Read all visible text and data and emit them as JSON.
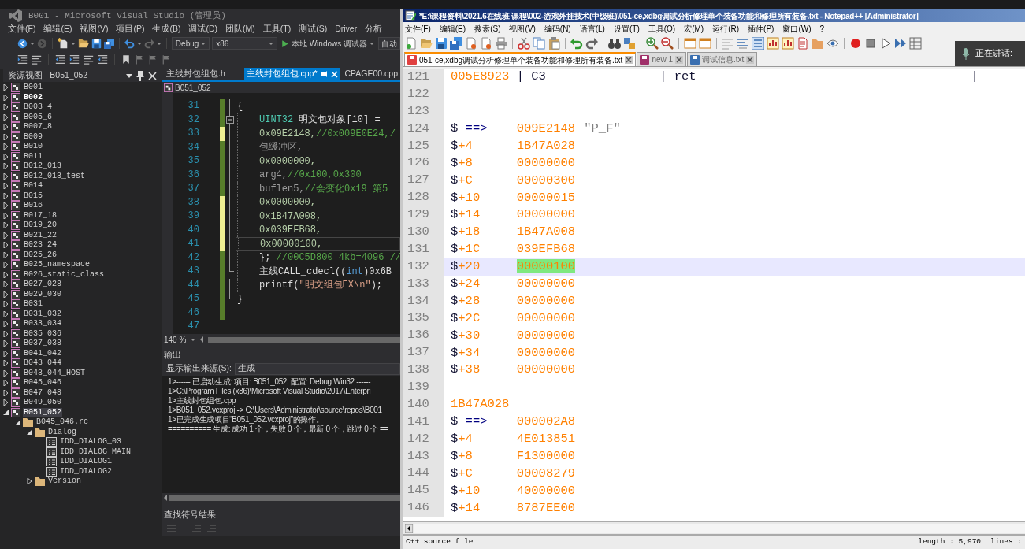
{
  "vs": {
    "title": "B001 - Microsoft Visual Studio (管理员)",
    "menu": [
      "文件(F)",
      "编辑(E)",
      "视图(V)",
      "项目(P)",
      "生成(B)",
      "调试(D)",
      "团队(M)",
      "工具(T)",
      "测试(S)",
      "Driver",
      "分析"
    ],
    "toolbar": {
      "configuration": "Debug",
      "platform": "x86",
      "run_button": "本地 Windows 调试器",
      "run_target": "自动"
    },
    "resource_view": {
      "title": "资源视图 - B051_052",
      "tree": [
        {
          "label": "B001",
          "kind": "project",
          "expanded": false,
          "selected": false,
          "bold": false
        },
        {
          "label": "B002",
          "kind": "project",
          "expanded": false,
          "selected": false,
          "bold": true
        },
        {
          "label": "B003_4",
          "kind": "project",
          "expanded": false,
          "selected": false,
          "bold": false
        },
        {
          "label": "B005_6",
          "kind": "project",
          "expanded": false,
          "selected": false,
          "bold": false
        },
        {
          "label": "B007_8",
          "kind": "project",
          "expanded": false,
          "selected": false,
          "bold": false
        },
        {
          "label": "B009",
          "kind": "project",
          "expanded": false,
          "selected": false,
          "bold": false
        },
        {
          "label": "B010",
          "kind": "project",
          "expanded": false,
          "selected": false,
          "bold": false
        },
        {
          "label": "B011",
          "kind": "project",
          "expanded": false,
          "selected": false,
          "bold": false
        },
        {
          "label": "B012_013",
          "kind": "project",
          "expanded": false,
          "selected": false,
          "bold": false
        },
        {
          "label": "B012_013_test",
          "kind": "project",
          "expanded": false,
          "selected": false,
          "bold": false
        },
        {
          "label": "B014",
          "kind": "project",
          "expanded": false,
          "selected": false,
          "bold": false
        },
        {
          "label": "B015",
          "kind": "project",
          "expanded": false,
          "selected": false,
          "bold": false
        },
        {
          "label": "B016",
          "kind": "project",
          "expanded": false,
          "selected": false,
          "bold": false
        },
        {
          "label": "B017_18",
          "kind": "project",
          "expanded": false,
          "selected": false,
          "bold": false
        },
        {
          "label": "B019_20",
          "kind": "project",
          "expanded": false,
          "selected": false,
          "bold": false
        },
        {
          "label": "B021_22",
          "kind": "project",
          "expanded": false,
          "selected": false,
          "bold": false
        },
        {
          "label": "B023_24",
          "kind": "project",
          "expanded": false,
          "selected": false,
          "bold": false
        },
        {
          "label": "B025_26",
          "kind": "project",
          "expanded": false,
          "selected": false,
          "bold": false
        },
        {
          "label": "B025_namespace",
          "kind": "project",
          "expanded": false,
          "selected": false,
          "bold": false
        },
        {
          "label": "B026_static_class",
          "kind": "project",
          "expanded": false,
          "selected": false,
          "bold": false
        },
        {
          "label": "B027_028",
          "kind": "project",
          "expanded": false,
          "selected": false,
          "bold": false
        },
        {
          "label": "B029_030",
          "kind": "project",
          "expanded": false,
          "selected": false,
          "bold": false
        },
        {
          "label": "B031",
          "kind": "project",
          "expanded": false,
          "selected": false,
          "bold": false
        },
        {
          "label": "B031_032",
          "kind": "project",
          "expanded": false,
          "selected": false,
          "bold": false
        },
        {
          "label": "B033_034",
          "kind": "project",
          "expanded": false,
          "selected": false,
          "bold": false
        },
        {
          "label": "B035_036",
          "kind": "project",
          "expanded": false,
          "selected": false,
          "bold": false
        },
        {
          "label": "B037_038",
          "kind": "project",
          "expanded": false,
          "selected": false,
          "bold": false
        },
        {
          "label": "B041_042",
          "kind": "project",
          "expanded": false,
          "selected": false,
          "bold": false
        },
        {
          "label": "B043_044",
          "kind": "project",
          "expanded": false,
          "selected": false,
          "bold": false
        },
        {
          "label": "B043_044_HOST",
          "kind": "project",
          "expanded": false,
          "selected": false,
          "bold": false
        },
        {
          "label": "B045_046",
          "kind": "project",
          "expanded": false,
          "selected": false,
          "bold": false
        },
        {
          "label": "B047_048",
          "kind": "project",
          "expanded": false,
          "selected": false,
          "bold": false
        },
        {
          "label": "B049_050",
          "kind": "project",
          "expanded": false,
          "selected": false,
          "bold": false
        },
        {
          "label": "B051_052",
          "kind": "project",
          "expanded": true,
          "selected": true,
          "bold": false,
          "children": [
            {
              "label": "B045_046.rc",
              "kind": "folder",
              "expanded": true,
              "selected": false,
              "bold": false,
              "children": [
                {
                  "label": "Dialog",
                  "kind": "folder",
                  "expanded": true,
                  "selected": false,
                  "bold": false,
                  "children": [
                    {
                      "label": "IDD_DIALOG_03",
                      "kind": "dialog",
                      "selected": false,
                      "bold": false
                    },
                    {
                      "label": "IDD_DIALOG_MAIN",
                      "kind": "dialog",
                      "selected": false,
                      "bold": false
                    },
                    {
                      "label": "IDD_DIALOG1",
                      "kind": "dialog",
                      "selected": false,
                      "bold": false
                    },
                    {
                      "label": "IDD_DIALOG2",
                      "kind": "dialog",
                      "selected": false,
                      "bold": false
                    }
                  ]
                },
                {
                  "label": "Version",
                  "kind": "folder",
                  "expanded": false,
                  "selected": false,
                  "bold": false
                }
              ]
            }
          ]
        }
      ]
    },
    "editor": {
      "tabs": [
        {
          "label": "主线封包组包.h",
          "selected": false
        },
        {
          "label": "主线封包组包.cpp*",
          "selected": true
        },
        {
          "label": "CPAGE00.cpp",
          "selected": false
        }
      ],
      "navigation": "B051_052",
      "lines": [
        {
          "number": "31",
          "changed": true,
          "saved": true,
          "in_fold": true,
          "fold_start": false,
          "fold_end": false,
          "indented": false,
          "current": false,
          "pieces": [
            {
              "text": "{",
              "kind": "text"
            }
          ]
        },
        {
          "number": "32",
          "changed": true,
          "saved": true,
          "in_fold": true,
          "fold_start": true,
          "fold_end": false,
          "indented": true,
          "current": false,
          "pieces": [
            {
              "text": "UINT32",
              "kind": "keyword"
            },
            {
              "text": " 明文包对象[10] = ",
              "kind": "text"
            }
          ]
        },
        {
          "number": "33",
          "changed": true,
          "saved": false,
          "in_fold": true,
          "fold_start": false,
          "fold_end": false,
          "indented": true,
          "current": false,
          "pieces": [
            {
              "text": "0x09E2148,",
              "kind": "number"
            },
            {
              "text": "//0x009E0E24,/",
              "kind": "comment"
            }
          ]
        },
        {
          "number": "34",
          "changed": true,
          "saved": true,
          "in_fold": true,
          "fold_start": false,
          "fold_end": false,
          "indented": true,
          "current": false,
          "pieces": [
            {
              "text": "包缓冲区,",
              "kind": "inactive"
            }
          ]
        },
        {
          "number": "35",
          "changed": true,
          "saved": true,
          "in_fold": true,
          "fold_start": false,
          "fold_end": false,
          "indented": true,
          "current": false,
          "pieces": [
            {
              "text": "0x0000000,",
              "kind": "number"
            }
          ]
        },
        {
          "number": "36",
          "changed": true,
          "saved": true,
          "in_fold": true,
          "fold_start": false,
          "fold_end": false,
          "indented": true,
          "current": false,
          "pieces": [
            {
              "text": "arg4,",
              "kind": "inactive"
            },
            {
              "text": "//0x100,0x300",
              "kind": "comment"
            }
          ]
        },
        {
          "number": "37",
          "changed": true,
          "saved": true,
          "in_fold": true,
          "fold_start": false,
          "fold_end": false,
          "indented": true,
          "current": false,
          "pieces": [
            {
              "text": "buflen5,",
              "kind": "inactive"
            },
            {
              "text": "//会变化0x19 第5",
              "kind": "comment"
            }
          ]
        },
        {
          "number": "38",
          "changed": true,
          "saved": false,
          "in_fold": true,
          "fold_start": false,
          "fold_end": false,
          "indented": true,
          "current": false,
          "pieces": [
            {
              "text": "0x0000000,",
              "kind": "number"
            }
          ]
        },
        {
          "number": "39",
          "changed": true,
          "saved": false,
          "in_fold": true,
          "fold_start": false,
          "fold_end": false,
          "indented": true,
          "current": false,
          "pieces": [
            {
              "text": "0x1B47A008,",
              "kind": "number"
            }
          ]
        },
        {
          "number": "40",
          "changed": true,
          "saved": false,
          "in_fold": true,
          "fold_start": false,
          "fold_end": false,
          "indented": true,
          "current": false,
          "pieces": [
            {
              "text": "0x039EFB68,",
              "kind": "number"
            }
          ]
        },
        {
          "number": "41",
          "changed": true,
          "saved": false,
          "in_fold": true,
          "fold_start": false,
          "fold_end": false,
          "indented": true,
          "current": true,
          "pieces": [
            {
              "text": "0x00000100,",
              "kind": "number"
            }
          ]
        },
        {
          "number": "42",
          "changed": true,
          "saved": true,
          "in_fold": true,
          "fold_start": false,
          "fold_end": false,
          "indented": true,
          "current": false,
          "pieces": [
            {
              "text": "};",
              "kind": "text"
            },
            {
              "text": " //00C5D800 4kb=4096 //",
              "kind": "comment"
            }
          ]
        },
        {
          "number": "43",
          "changed": true,
          "saved": true,
          "in_fold": true,
          "fold_start": false,
          "fold_end": true,
          "indented": true,
          "current": false,
          "pieces": [
            {
              "text": "主线CALL_cdecl((",
              "kind": "text"
            },
            {
              "text": "int",
              "kind": "type"
            },
            {
              "text": ")0x6B",
              "kind": "text"
            }
          ]
        },
        {
          "number": "44",
          "changed": true,
          "saved": true,
          "in_fold": true,
          "fold_start": false,
          "fold_end": false,
          "indented": true,
          "current": false,
          "pieces": [
            {
              "text": "printf(",
              "kind": "text"
            },
            {
              "text": "\"明文组包EX\\n\"",
              "kind": "string"
            },
            {
              "text": ");",
              "kind": "text"
            }
          ]
        },
        {
          "number": "45",
          "changed": true,
          "saved": true,
          "in_fold": true,
          "fold_start": false,
          "fold_end": true,
          "indented": false,
          "current": false,
          "pieces": [
            {
              "text": "}",
              "kind": "text"
            }
          ]
        },
        {
          "number": "46",
          "changed": true,
          "saved": true,
          "in_fold": false,
          "fold_start": false,
          "fold_end": false,
          "current": false
        },
        {
          "number": "47",
          "changed": false,
          "in_fold": false,
          "fold_start": false,
          "fold_end": false,
          "current": false
        }
      ],
      "zoom": "140 %"
    },
    "output": {
      "title": "输出",
      "source_label": "显示输出来源(S):",
      "source": "生成",
      "lines": [
        "1>------ 已启动生成: 项目: B051_052, 配置: Debug Win32 ------",
        "1>C:\\Program Files (x86)\\Microsoft Visual Studio\\2017\\Enterpri",
        "1>主线封包组包.cpp",
        "1>B051_052.vcxproj -> C:\\Users\\Administrator\\source\\repos\\B001",
        "1>已完成生成项目“B051_052.vcxproj”的操作。",
        "========== 生成: 成功 1 个，失败 0 个，最新 0 个，跳过 0 个 =="
      ]
    },
    "find_results": {
      "title": "查找符号结果"
    }
  },
  "notepad": {
    "title": "*E:\\课程资料\\2021.6在线班 课程\\002-游戏外挂技术(中级班)\\051-ce,xdbg调试分析修理单个装备功能和修理所有装备.txt - Notepad++ [Administrator]",
    "menu": [
      "文件(F)",
      "编辑(E)",
      "搜索(S)",
      "视图(V)",
      "编码(N)",
      "语言(L)",
      "设置(T)",
      "工具(O)",
      "宏(M)",
      "运行(R)",
      "插件(P)",
      "窗口(W)",
      "?"
    ],
    "tabs": [
      {
        "label": "051-ce,xdbg调试分析修理单个装备功能和修理所有装备.txt",
        "selected": true,
        "saved": false
      },
      {
        "label": "new 1",
        "selected": false,
        "saved": false
      },
      {
        "label": "调试信息.txt",
        "selected": false,
        "saved": true
      }
    ],
    "lines": [
      {
        "number": "121",
        "kind": "disasm",
        "current": false,
        "cols": [
          [
            {
              "text": "005E8923",
              "kind": "number"
            }
          ],
          [
            {
              "text": "| C3",
              "kind": "text"
            }
          ],
          [
            {
              "text": "| ret",
              "kind": "text"
            }
          ],
          [
            {
              "text": "|",
              "kind": "text"
            }
          ]
        ]
      },
      {
        "number": "122",
        "kind": "empty",
        "current": false
      },
      {
        "number": "123",
        "kind": "empty",
        "current": false
      },
      {
        "number": "124",
        "kind": "pointer",
        "current": false,
        "cols": [
          [
            {
              "text": "$",
              "kind": "text"
            },
            {
              "text": " ==>",
              "kind": "operator"
            }
          ],
          [
            {
              "text": "009E2148",
              "kind": "number"
            }
          ],
          [
            {
              "text": "\"P_F\"",
              "kind": "string"
            }
          ]
        ]
      },
      {
        "number": "125",
        "kind": "dump",
        "current": false,
        "cols": [
          [
            {
              "text": "$",
              "kind": "text"
            },
            {
              "text": "+4",
              "kind": "number"
            }
          ],
          [
            {
              "text": "1B47A028",
              "kind": "number"
            }
          ]
        ]
      },
      {
        "number": "126",
        "kind": "dump",
        "current": false,
        "cols": [
          [
            {
              "text": "$",
              "kind": "text"
            },
            {
              "text": "+8",
              "kind": "number"
            }
          ],
          [
            {
              "text": "00000000",
              "kind": "number"
            }
          ]
        ]
      },
      {
        "number": "127",
        "kind": "dump",
        "current": false,
        "cols": [
          [
            {
              "text": "$",
              "kind": "text"
            },
            {
              "text": "+C",
              "kind": "number"
            }
          ],
          [
            {
              "text": "00000300",
              "kind": "number"
            }
          ]
        ]
      },
      {
        "number": "128",
        "kind": "dump",
        "current": false,
        "cols": [
          [
            {
              "text": "$",
              "kind": "text"
            },
            {
              "text": "+10",
              "kind": "number"
            }
          ],
          [
            {
              "text": "00000015",
              "kind": "number"
            }
          ]
        ]
      },
      {
        "number": "129",
        "kind": "dump",
        "current": false,
        "cols": [
          [
            {
              "text": "$",
              "kind": "text"
            },
            {
              "text": "+14",
              "kind": "number"
            }
          ],
          [
            {
              "text": "00000000",
              "kind": "number"
            }
          ]
        ]
      },
      {
        "number": "130",
        "kind": "dump",
        "current": false,
        "cols": [
          [
            {
              "text": "$",
              "kind": "text"
            },
            {
              "text": "+18",
              "kind": "number"
            }
          ],
          [
            {
              "text": "1B47A008",
              "kind": "number"
            }
          ]
        ]
      },
      {
        "number": "131",
        "kind": "dump",
        "current": false,
        "cols": [
          [
            {
              "text": "$",
              "kind": "text"
            },
            {
              "text": "+1C",
              "kind": "number"
            }
          ],
          [
            {
              "text": "039EFB68",
              "kind": "number"
            }
          ]
        ]
      },
      {
        "number": "132",
        "kind": "dump",
        "current": true,
        "cols": [
          [
            {
              "text": "$",
              "kind": "text"
            },
            {
              "text": "+20",
              "kind": "number"
            }
          ],
          [
            {
              "text": "00000100",
              "kind": "number",
              "highlighted": true
            }
          ]
        ]
      },
      {
        "number": "133",
        "kind": "dump",
        "current": false,
        "cols": [
          [
            {
              "text": "$",
              "kind": "text"
            },
            {
              "text": "+24",
              "kind": "number"
            }
          ],
          [
            {
              "text": "00000000",
              "kind": "number"
            }
          ]
        ]
      },
      {
        "number": "134",
        "kind": "dump",
        "current": false,
        "cols": [
          [
            {
              "text": "$",
              "kind": "text"
            },
            {
              "text": "+28",
              "kind": "number"
            }
          ],
          [
            {
              "text": "00000000",
              "kind": "number"
            }
          ]
        ]
      },
      {
        "number": "135",
        "kind": "dump",
        "current": false,
        "cols": [
          [
            {
              "text": "$",
              "kind": "text"
            },
            {
              "text": "+2C",
              "kind": "number"
            }
          ],
          [
            {
              "text": "00000000",
              "kind": "number"
            }
          ]
        ]
      },
      {
        "number": "136",
        "kind": "dump",
        "current": false,
        "cols": [
          [
            {
              "text": "$",
              "kind": "text"
            },
            {
              "text": "+30",
              "kind": "number"
            }
          ],
          [
            {
              "text": "00000000",
              "kind": "number"
            }
          ]
        ]
      },
      {
        "number": "137",
        "kind": "dump",
        "current": false,
        "cols": [
          [
            {
              "text": "$",
              "kind": "text"
            },
            {
              "text": "+34",
              "kind": "number"
            }
          ],
          [
            {
              "text": "00000000",
              "kind": "number"
            }
          ]
        ]
      },
      {
        "number": "138",
        "kind": "dump",
        "current": false,
        "cols": [
          [
            {
              "text": "$",
              "kind": "text"
            },
            {
              "text": "+38",
              "kind": "number"
            }
          ],
          [
            {
              "text": "00000000",
              "kind": "number"
            }
          ]
        ]
      },
      {
        "number": "139",
        "kind": "empty",
        "current": false
      },
      {
        "number": "140",
        "kind": "label",
        "current": false,
        "cols": [
          [
            {
              "text": "1B47A028",
              "kind": "number"
            }
          ]
        ]
      },
      {
        "number": "141",
        "kind": "pointer",
        "current": false,
        "cols": [
          [
            {
              "text": "$",
              "kind": "text"
            },
            {
              "text": " ==>",
              "kind": "operator"
            }
          ],
          [
            {
              "text": "000002A8",
              "kind": "number"
            }
          ]
        ]
      },
      {
        "number": "142",
        "kind": "dump",
        "current": false,
        "cols": [
          [
            {
              "text": "$",
              "kind": "text"
            },
            {
              "text": "+4",
              "kind": "number"
            }
          ],
          [
            {
              "text": "4E013851",
              "kind": "number"
            }
          ]
        ]
      },
      {
        "number": "143",
        "kind": "dump",
        "current": false,
        "cols": [
          [
            {
              "text": "$",
              "kind": "text"
            },
            {
              "text": "+8",
              "kind": "number"
            }
          ],
          [
            {
              "text": "F1300000",
              "kind": "number"
            }
          ]
        ]
      },
      {
        "number": "144",
        "kind": "dump",
        "current": false,
        "cols": [
          [
            {
              "text": "$",
              "kind": "text"
            },
            {
              "text": "+C",
              "kind": "number"
            }
          ],
          [
            {
              "text": "00008279",
              "kind": "number"
            }
          ]
        ]
      },
      {
        "number": "145",
        "kind": "dump",
        "current": false,
        "cols": [
          [
            {
              "text": "$",
              "kind": "text"
            },
            {
              "text": "+10",
              "kind": "number"
            }
          ],
          [
            {
              "text": "40000000",
              "kind": "number"
            }
          ]
        ]
      },
      {
        "number": "146",
        "kind": "dump",
        "current": false,
        "cols": [
          [
            {
              "text": "$",
              "kind": "text"
            },
            {
              "text": "+14",
              "kind": "number"
            }
          ],
          [
            {
              "text": "8787EE00",
              "kind": "number"
            }
          ]
        ]
      }
    ],
    "status_bar": {
      "file_type": "C++ source file",
      "length": "length : 5,970",
      "lines": "lines :"
    }
  },
  "notification": {
    "text": "正在讲话:"
  }
}
